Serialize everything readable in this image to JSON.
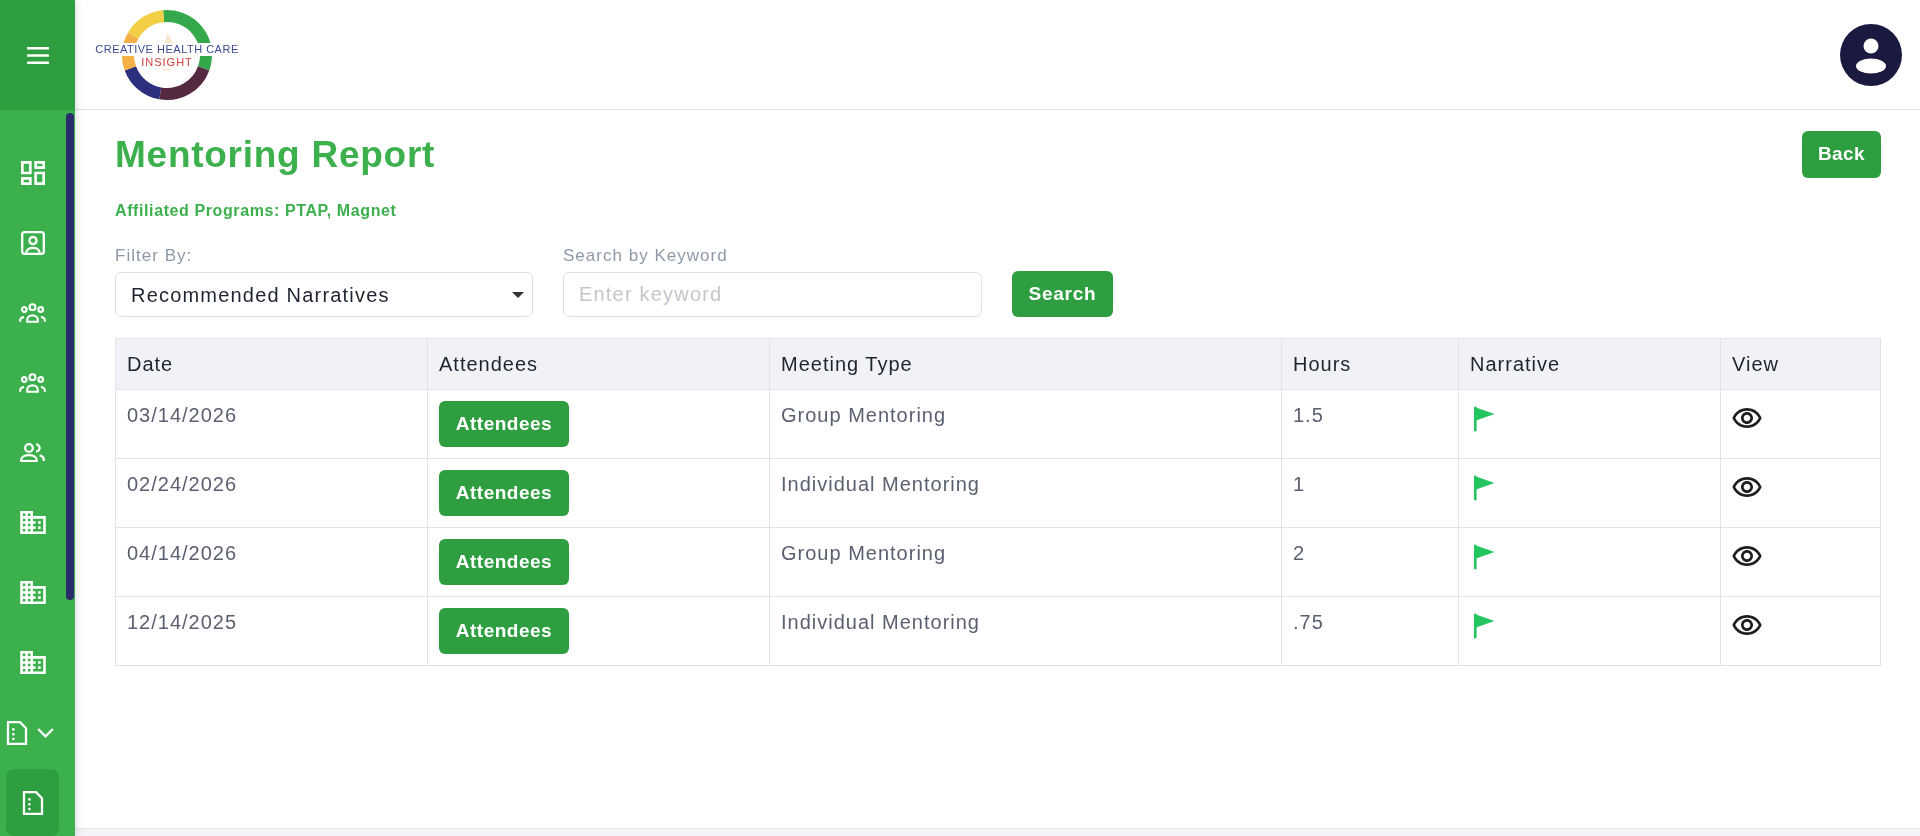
{
  "sidebar": {
    "items": [
      {
        "kind": "dashboard",
        "selected": false
      },
      {
        "kind": "contact",
        "selected": false
      },
      {
        "kind": "groups",
        "selected": false
      },
      {
        "kind": "groups",
        "selected": false
      },
      {
        "kind": "people",
        "selected": false
      },
      {
        "kind": "building",
        "selected": false
      },
      {
        "kind": "building",
        "selected": false
      },
      {
        "kind": "building",
        "selected": false
      },
      {
        "kind": "document",
        "selected": false,
        "expanded": false
      },
      {
        "kind": "document",
        "selected": true
      }
    ]
  },
  "header": {
    "logo": {
      "line_1": "CREATIVE HEALTH CARE",
      "line_2": "INSIGHT"
    }
  },
  "page": {
    "title": "Mentoring Report",
    "back_button": "Back",
    "subtitle": "Affiliated Programs: PTAP, Magnet",
    "filter": {
      "label": "Filter By:",
      "value": "Recommended Narratives"
    },
    "search": {
      "label": "Search by Keyword",
      "placeholder": "Enter keyword"
    },
    "search_button": "Search"
  },
  "table": {
    "columns": [
      "Date",
      "Attendees",
      "Meeting Type",
      "Hours",
      "Narrative",
      "View"
    ],
    "rows": [
      {
        "date": "03/14/2026",
        "attendees_button": "Attendees",
        "meeting_type": "Group Mentoring",
        "hours": "1.5"
      },
      {
        "date": "02/24/2026",
        "attendees_button": "Attendees",
        "meeting_type": "Individual Mentoring",
        "hours": "1"
      },
      {
        "date": "04/14/2026",
        "attendees_button": "Attendees",
        "meeting_type": "Group Mentoring",
        "hours": "2"
      },
      {
        "date": "12/14/2025",
        "attendees_button": "Attendees",
        "meeting_type": "Individual Mentoring",
        "hours": ".75"
      }
    ]
  }
}
